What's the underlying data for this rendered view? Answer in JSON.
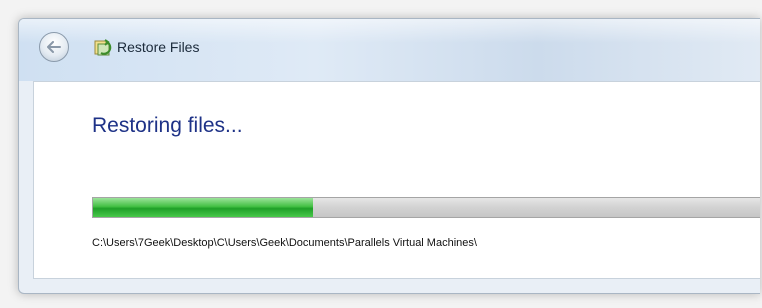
{
  "window": {
    "title": "Restore Files"
  },
  "main": {
    "heading": "Restoring files...",
    "progress_fraction": 0.33,
    "current_path": "C:\\Users\\7Geek\\Desktop\\C\\Users\\Geek\\Documents\\Parallels Virtual Machines\\"
  },
  "icons": {
    "back": "back-arrow-icon",
    "title": "restore-files-icon"
  },
  "colors": {
    "heading": "#1e3287",
    "progress_green": "#2fae35",
    "progress_track": "#d0d0d0"
  }
}
